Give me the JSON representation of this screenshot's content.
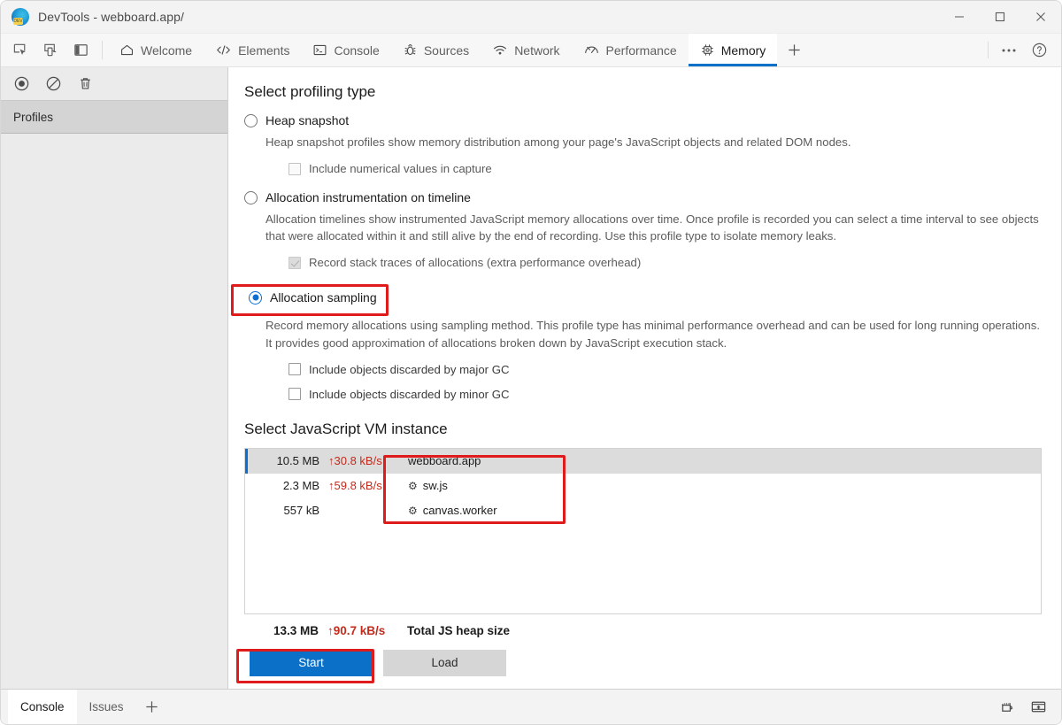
{
  "window": {
    "title": "DevTools - webboard.app/",
    "logo_icon": "edge-devtools-logo",
    "controls": [
      {
        "name": "minimize-button",
        "icon": "minimize-icon"
      },
      {
        "name": "maximize-button",
        "icon": "maximize-icon"
      },
      {
        "name": "close-button",
        "icon": "close-icon"
      }
    ]
  },
  "toolbar": {
    "inspect_icon": "inspect-element-icon",
    "device_icon": "device-toolbar-icon",
    "dock_icon": "dock-side-icon",
    "more_icon": "more-options-icon",
    "help_icon": "help-icon"
  },
  "tabs": [
    {
      "label": "Welcome",
      "icon": "home-icon",
      "active": false
    },
    {
      "label": "Elements",
      "icon": "code-icon",
      "active": false
    },
    {
      "label": "Console",
      "icon": "console-icon",
      "active": false
    },
    {
      "label": "Sources",
      "icon": "bug-icon",
      "active": false
    },
    {
      "label": "Network",
      "icon": "wifi-icon",
      "active": false
    },
    {
      "label": "Performance",
      "icon": "gauge-icon",
      "active": false
    },
    {
      "label": "Memory",
      "icon": "chip-icon",
      "active": true
    }
  ],
  "tab_add_label": "+",
  "sidebar": {
    "record_icon": "record-icon",
    "clear_icon": "clear-icon",
    "delete_icon": "trash-icon",
    "header": "Profiles"
  },
  "main": {
    "profiling_section_title": "Select profiling type",
    "options": [
      {
        "label": "Heap snapshot",
        "selected": false,
        "description": "Heap snapshot profiles show memory distribution among your page's JavaScript objects and related DOM nodes.",
        "checkboxes": [
          {
            "label": "Include numerical values in capture",
            "checked": false,
            "disabled": true
          }
        ]
      },
      {
        "label": "Allocation instrumentation on timeline",
        "selected": false,
        "description": "Allocation timelines show instrumented JavaScript memory allocations over time. Once profile is recorded you can select a time interval to see objects that were allocated within it and still alive by the end of recording. Use this profile type to isolate memory leaks.",
        "checkboxes": [
          {
            "label": "Record stack traces of allocations (extra performance overhead)",
            "checked": true,
            "disabled": true
          }
        ]
      },
      {
        "label": "Allocation sampling",
        "selected": true,
        "description": "Record memory allocations using sampling method. This profile type has minimal performance overhead and can be used for long running operations. It provides good approximation of allocations broken down by JavaScript execution stack.",
        "checkboxes": [
          {
            "label": "Include objects discarded by major GC",
            "checked": false,
            "disabled": false
          },
          {
            "label": "Include objects discarded by minor GC",
            "checked": false,
            "disabled": false
          }
        ]
      }
    ],
    "vm_section_title": "Select JavaScript VM instance",
    "vm_rows": [
      {
        "size": "10.5 MB",
        "rate": "↑30.8 kB/s",
        "name": "webboard.app",
        "icon": "",
        "selected": true
      },
      {
        "size": "2.3 MB",
        "rate": "↑59.8 kB/s",
        "name": "sw.js",
        "icon": "gear-icon",
        "selected": false
      },
      {
        "size": "557 kB",
        "rate": "",
        "name": "canvas.worker",
        "icon": "gear-icon",
        "selected": false
      }
    ],
    "total": {
      "size": "13.3 MB",
      "rate": "↑90.7 kB/s",
      "label": "Total JS heap size"
    },
    "start_button": "Start",
    "load_button": "Load"
  },
  "drawer": {
    "tabs": [
      {
        "label": "Console",
        "active": true
      },
      {
        "label": "Issues",
        "active": false
      }
    ],
    "add_label": "+",
    "settings_icon": "console-settings-icon",
    "dock_icon": "dock-bottom-icon"
  },
  "colors": {
    "accent": "#0a70c8",
    "highlight": "#e01b1b",
    "rate_red": "#c42b1c",
    "selected_row": "#dcdcdc"
  }
}
